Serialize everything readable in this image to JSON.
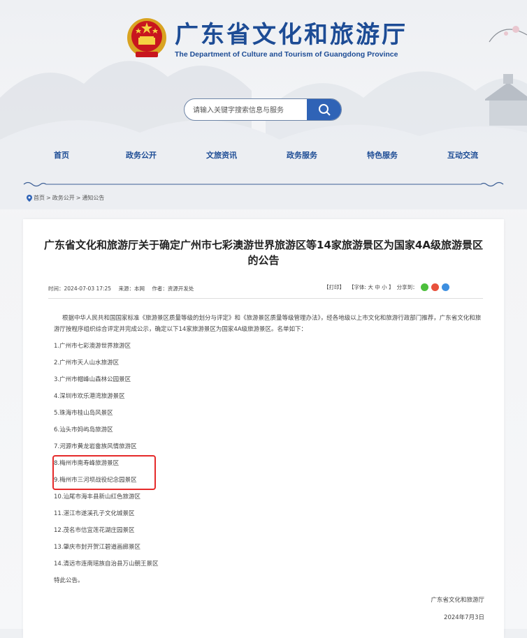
{
  "header": {
    "title": "广东省文化和旅游厅",
    "subtitle": "The Department of Culture and Tourism of Guangdong Province"
  },
  "search": {
    "placeholder": "请输入关键字搜索信息与服务"
  },
  "nav": {
    "items": [
      "首页",
      "政务公开",
      "文旅资讯",
      "政务服务",
      "特色服务",
      "互动交流"
    ]
  },
  "breadcrumb": {
    "items": [
      "首页",
      "政务公开",
      "通知公告"
    ],
    "separator": ">"
  },
  "article": {
    "title": "广东省文化和旅游厅关于确定广州市七彩澳游世界旅游区等14家旅游景区为国家4A级旅游景区的公告",
    "meta": {
      "time": "时间：2024-07-03 17:25",
      "source": "来源：本网",
      "author": "作者：资源开发处"
    },
    "tools": {
      "print": "【打印】",
      "font": "【字体: 大  中  小 】",
      "share": "分享到："
    },
    "intro": "根据中华人民共和国国家标准《旅游景区质量等级的划分与评定》和《旅游景区质量等级管理办法》，经各地级以上市文化和旅游行政部门推荐，广东省文化和旅游厅按程序组织综合评定并完成公示，确定以下14家旅游景区为国家4A级旅游景区。名单如下：",
    "list": [
      "1.广州市七彩澳游世界旅游区",
      "2.广州市天人山水旅游区",
      "3.广州市帽峰山森林公园景区",
      "4.深圳市欢乐港湾旅游景区",
      "5.珠海市桂山岛风景区",
      "6.汕头市妈屿岛旅游区",
      "7.河源市黄龙岩畲族风情旅游区",
      "8.梅州市南寿峰旅游景区",
      "9.梅州市三河坝战役纪念园景区",
      "10.汕尾市海丰县新山红色旅游区",
      "11.湛江市遂溪孔子文化城景区",
      "12.茂名市信宜莲花湖庄园景区",
      "13.肇庆市封开贺江碧道画廊景区",
      "14.清远市连南瑶族自治县万山朝王景区"
    ],
    "closing": "特此公告。",
    "signature": "广东省文化和旅游厅",
    "date": "2024年7月3日"
  },
  "colors": {
    "brand": "#1d4c95",
    "search_button": "#2f63b6",
    "highlight": "#e52a2a",
    "wechat": "#4cbf3c",
    "weibo": "#e8513c",
    "qq": "#3d8fe0"
  }
}
